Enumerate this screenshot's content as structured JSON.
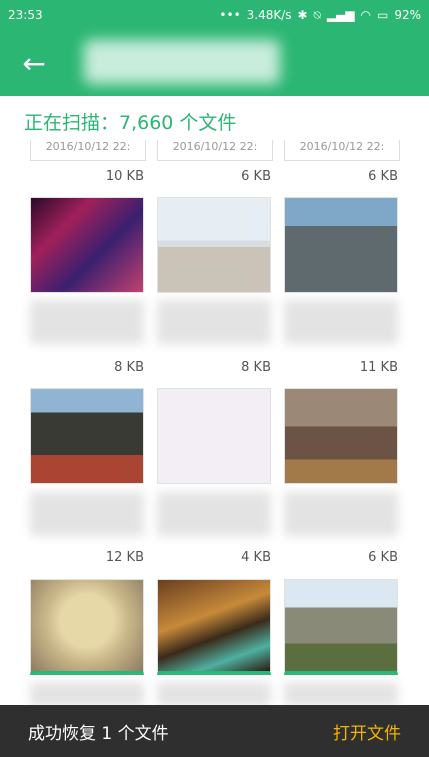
{
  "status_bar": {
    "time": "23:53",
    "speed": "3.48K/s",
    "battery": "92%"
  },
  "app_bar": {
    "back_icon": "arrow-left-icon"
  },
  "scan_text": "正在扫描：7,660 个文件",
  "top_row_dates": [
    "2016/10/12 22:",
    "2016/10/12 22:",
    "2016/10/12 22:"
  ],
  "top_row_sizes": [
    "10 KB",
    "6 KB",
    "6 KB"
  ],
  "grid": [
    {
      "size": "8 KB",
      "photo": "night-scene-photo",
      "selected": false
    },
    {
      "size": "8 KB",
      "photo": "plaza-tents-photo",
      "selected": false
    },
    {
      "size": "11 KB",
      "photo": "building-facade-photo",
      "selected": false
    },
    {
      "size": "12 KB",
      "photo": "temple-gate-photo",
      "selected": false
    },
    {
      "size": "4 KB",
      "photo": "blank-photo",
      "selected": false
    },
    {
      "size": "6 KB",
      "photo": "room-desk-photo",
      "selected": false
    },
    {
      "size": "",
      "photo": "food-rice-photo",
      "selected": true
    },
    {
      "size": "",
      "photo": "colorful-abstract-photo",
      "selected": true
    },
    {
      "size": "",
      "photo": "mountain-photo",
      "selected": true
    }
  ],
  "bottom_bar": {
    "message": "成功恢复 1 个文件",
    "action": "打开文件"
  }
}
